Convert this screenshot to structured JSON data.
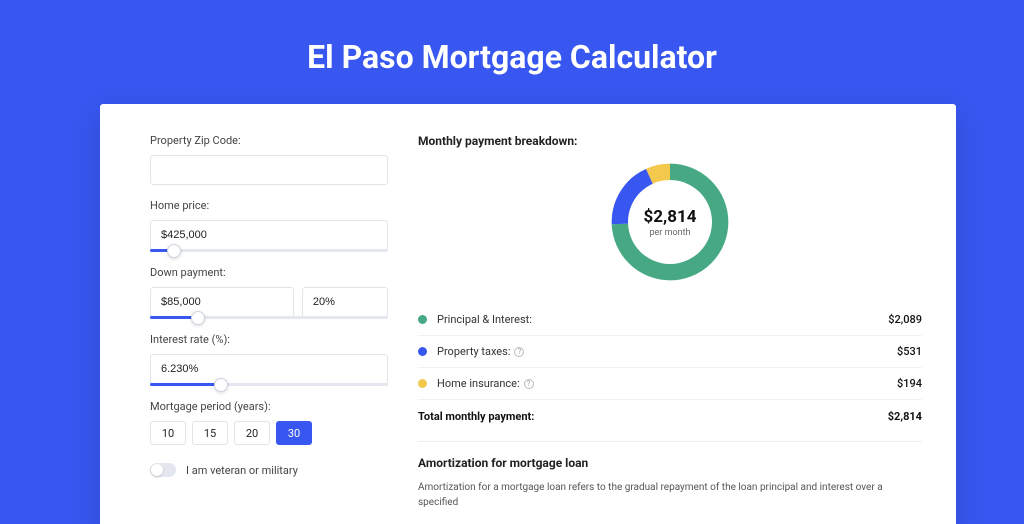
{
  "page": {
    "title": "El Paso Mortgage Calculator"
  },
  "form": {
    "zip": {
      "label": "Property Zip Code:",
      "value": ""
    },
    "price": {
      "label": "Home price:",
      "value": "$425,000",
      "slider_pct": 10
    },
    "down": {
      "label": "Down payment:",
      "amount": "$85,000",
      "percent": "20%",
      "slider_pct": 20
    },
    "rate": {
      "label": "Interest rate (%):",
      "value": "6.230%",
      "slider_pct": 30
    },
    "period": {
      "label": "Mortgage period (years):",
      "options": [
        "10",
        "15",
        "20",
        "30"
      ],
      "selected": "30"
    },
    "veteran": {
      "label": "I am veteran or military",
      "checked": false
    }
  },
  "breakdown": {
    "title": "Monthly payment breakdown:",
    "center_amount": "$2,814",
    "center_sub": "per month",
    "items": [
      {
        "label": "Principal & Interest:",
        "value": "$2,089",
        "color": "#47a884",
        "info": false
      },
      {
        "label": "Property taxes:",
        "value": "$531",
        "color": "#3757f0",
        "info": true
      },
      {
        "label": "Home insurance:",
        "value": "$194",
        "color": "#f2c94c",
        "info": true
      }
    ],
    "total_label": "Total monthly payment:",
    "total_value": "$2,814"
  },
  "chart_data": {
    "type": "pie",
    "title": "Monthly payment breakdown",
    "series": [
      {
        "name": "Principal & Interest",
        "value": 2089,
        "color": "#47a884"
      },
      {
        "name": "Property taxes",
        "value": 531,
        "color": "#3757f0"
      },
      {
        "name": "Home insurance",
        "value": 194,
        "color": "#f2c94c"
      }
    ],
    "total": 2814,
    "unit": "USD per month"
  },
  "amortization": {
    "title": "Amortization for mortgage loan",
    "text": "Amortization for a mortgage loan refers to the gradual repayment of the loan principal and interest over a specified"
  }
}
